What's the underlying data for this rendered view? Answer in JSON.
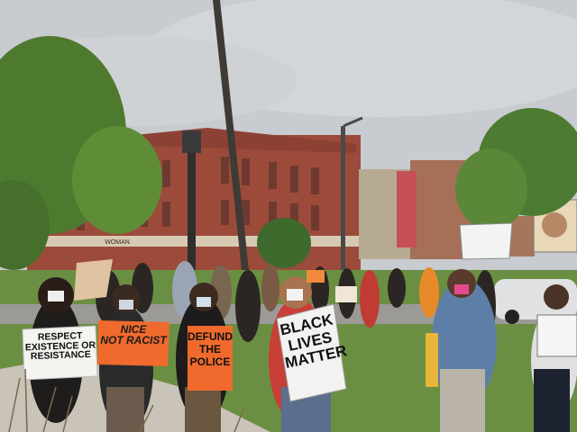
{
  "signs": {
    "respect": "RESPECT\nEXISTENCE OR\nRESISTANCE",
    "nice": "NICE\nNOT RACIST",
    "defund": "DEFUND\nTHE\nPOLICE",
    "blm": "BLACK\nLIVES\nMATTER",
    "bldg": "WOMAN"
  },
  "colors": {
    "sky": "#c9ccd0",
    "brick": "#9a4a3a",
    "grass": "#5f8d3c",
    "orange_sign": "#ef6a2c",
    "white_sign": "#f1f1ef"
  }
}
